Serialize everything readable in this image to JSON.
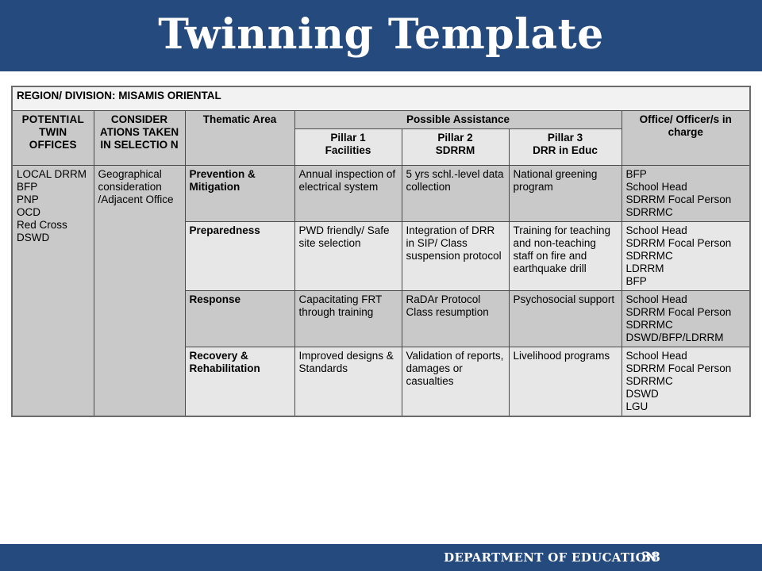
{
  "slide": {
    "title": "Twinning Template",
    "accent_color": "#254a7e"
  },
  "table": {
    "region_row": "REGION/ DIVISION: MISAMIS ORIENTAL",
    "headers": {
      "potential_twin_offices": "POTENTIAL TWIN OFFICES",
      "considerations": "CONSIDER ATIONS TAKEN IN SELECTIO N",
      "thematic_area": "Thematic Area",
      "possible_assistance": "Possible Assistance",
      "office_in_charge": "Office/ Officer/s in charge"
    },
    "pillars": {
      "pillar1_line1": "Pillar 1",
      "pillar1_line2": "Facilities",
      "pillar2_line1": "Pillar 2",
      "pillar2_line2": "SDRRM",
      "pillar3_line1": "Pillar 3",
      "pillar3_line2": "DRR in Educ"
    },
    "potential_twin_offices_value": "LOCAL DRRM\nBFP\nPNP\nOCD\nRed Cross\nDSWD",
    "considerations_value": "Geographical consideration /Adjacent Office",
    "rows": [
      {
        "thematic_area": "Prevention & Mitigation",
        "pillar1": "Annual inspection of electrical system",
        "pillar2": "5 yrs schl.-level data collection",
        "pillar3": "National greening program",
        "office": "BFP\nSchool Head\nSDRRM Focal Person\nSDRRMC"
      },
      {
        "thematic_area": "Preparedness",
        "pillar1": "PWD friendly/ Safe site selection",
        "pillar2": "Integration of DRR in SIP/ Class suspension protocol",
        "pillar3": "Training for teaching and non-teaching staff on fire and earthquake drill",
        "office": "School Head\nSDRRM Focal Person\nSDRRMC\nLDRRM\nBFP"
      },
      {
        "thematic_area": "Response",
        "pillar1": "Capacitating FRT through training",
        "pillar2": "RaDAr  Protocol Class resumption",
        "pillar3": "Psychosocial support",
        "office": "School Head\nSDRRM Focal Person\nSDRRMC\nDSWD/BFP/LDRRM"
      },
      {
        "thematic_area": "Recovery  & Rehabilitation",
        "pillar1": "Improved designs & Standards",
        "pillar2": "Validation of reports, damages or casualties",
        "pillar3": "Livelihood programs",
        "office": "School Head\nSDRRM Focal Person\nSDRRMC\nDSWD\nLGU"
      }
    ]
  },
  "footer": {
    "department": "DEPARTMENT OF EDUCATION",
    "page_number": "38"
  }
}
